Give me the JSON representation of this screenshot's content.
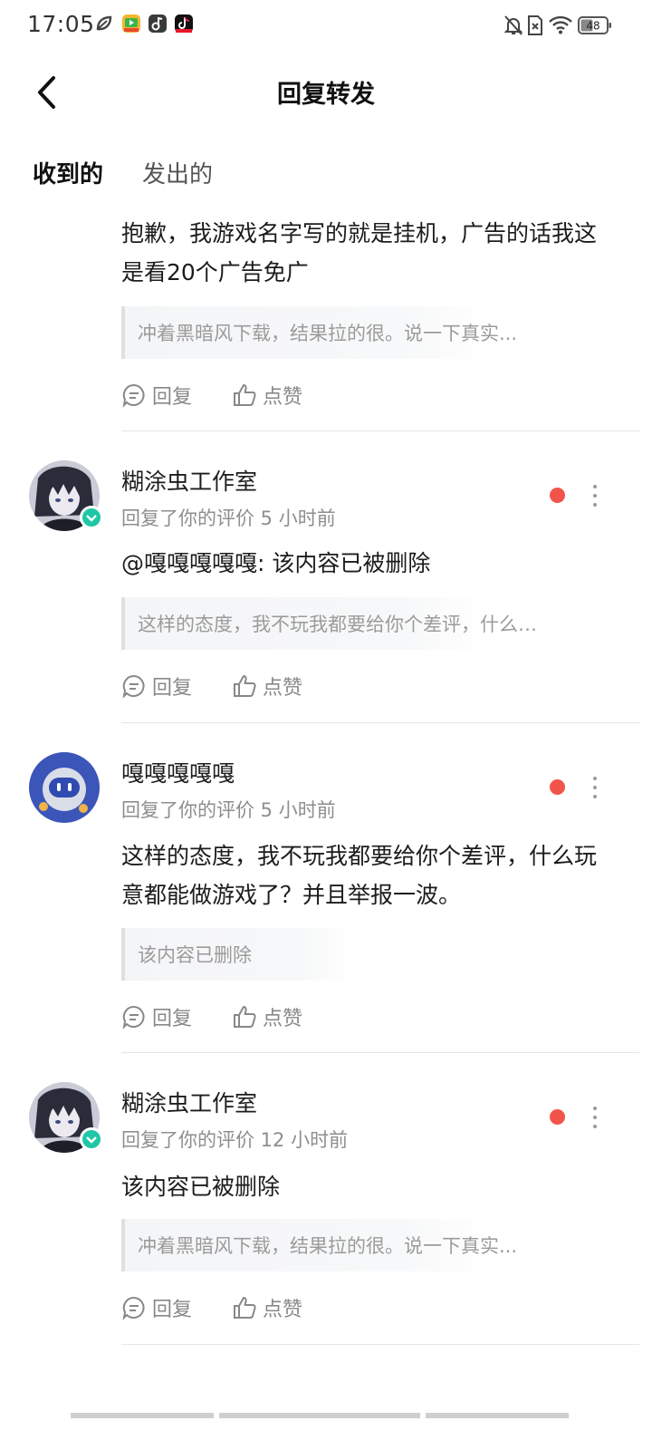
{
  "status_bar": {
    "time": "17:05",
    "battery": "48",
    "app_icons": [
      "leaf-icon",
      "video-app-icon",
      "music-app-icon",
      "tiktok-icon"
    ],
    "right_icons": [
      "bell-off-icon",
      "sim-off-icon",
      "wifi-icon",
      "battery-icon"
    ]
  },
  "header": {
    "title": "回复转发",
    "back_icon": "chevron-left-icon"
  },
  "tabs": [
    {
      "label": "收到的",
      "active": true
    },
    {
      "label": "发出的",
      "active": false
    }
  ],
  "colors": {
    "accent": "#16d6c8",
    "unread": "#f2544c",
    "verified": "#1fc7a6"
  },
  "items": [
    {
      "content": "抱歉，我游戏名字写的就是挂机，广告的话我这是看20个广告免广",
      "quote": "冲着黑暗风下载，结果拉的很。说一下真实...",
      "reply_label": "回复",
      "like_label": "点赞"
    },
    {
      "username": "糊涂虫工作室",
      "meta": "回复了你的评价 5 小时前",
      "content": "@嘎嘎嘎嘎嘎: 该内容已被删除",
      "quote": "这样的态度，我不玩我都要给你个差评，什么…",
      "reply_label": "回复",
      "like_label": "点赞",
      "verified": true
    },
    {
      "username": "嘎嘎嘎嘎嘎",
      "meta": "回复了你的评价 5 小时前",
      "content": "这样的态度，我不玩我都要给你个差评，什么玩意都能做游戏了？并且举报一波。",
      "quote": "该内容已删除",
      "reply_label": "回复",
      "like_label": "点赞",
      "verified": false
    },
    {
      "username": "糊涂虫工作室",
      "meta": "回复了你的评价 12 小时前",
      "content": "该内容已被删除",
      "quote": "冲着黑暗风下载，结果拉的很。说一下真实...",
      "reply_label": "回复",
      "like_label": "点赞",
      "verified": true
    }
  ]
}
